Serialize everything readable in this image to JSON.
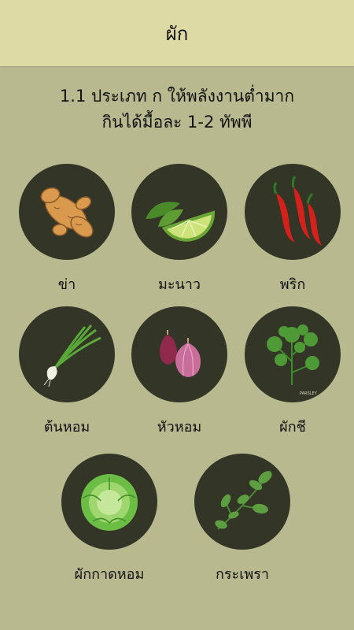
{
  "header": {
    "title": "ผัก"
  },
  "section": {
    "line1": "1.1 ประเภท ก ให้พลังงานต่ำมาก",
    "line2": "กินได้มื้อละ 1-2 ทัพพี"
  },
  "vegetables": [
    {
      "label": "ข่า",
      "icon": "galangal-icon"
    },
    {
      "label": "มะนาว",
      "icon": "lime-icon"
    },
    {
      "label": "พริก",
      "icon": "chili-icon"
    },
    {
      "label": "ต้นหอม",
      "icon": "green-onion-icon"
    },
    {
      "label": "หัวหอม",
      "icon": "shallot-icon"
    },
    {
      "label": "ผักชี",
      "icon": "coriander-icon",
      "image_text": "PARSLEY"
    },
    {
      "label": "ผักกาดหอม",
      "icon": "lettuce-icon"
    },
    {
      "label": "กระเพรา",
      "icon": "holy-basil-icon"
    }
  ],
  "colors": {
    "background": "#b8b98f",
    "header": "#dedaa6",
    "circle": "#333526"
  }
}
